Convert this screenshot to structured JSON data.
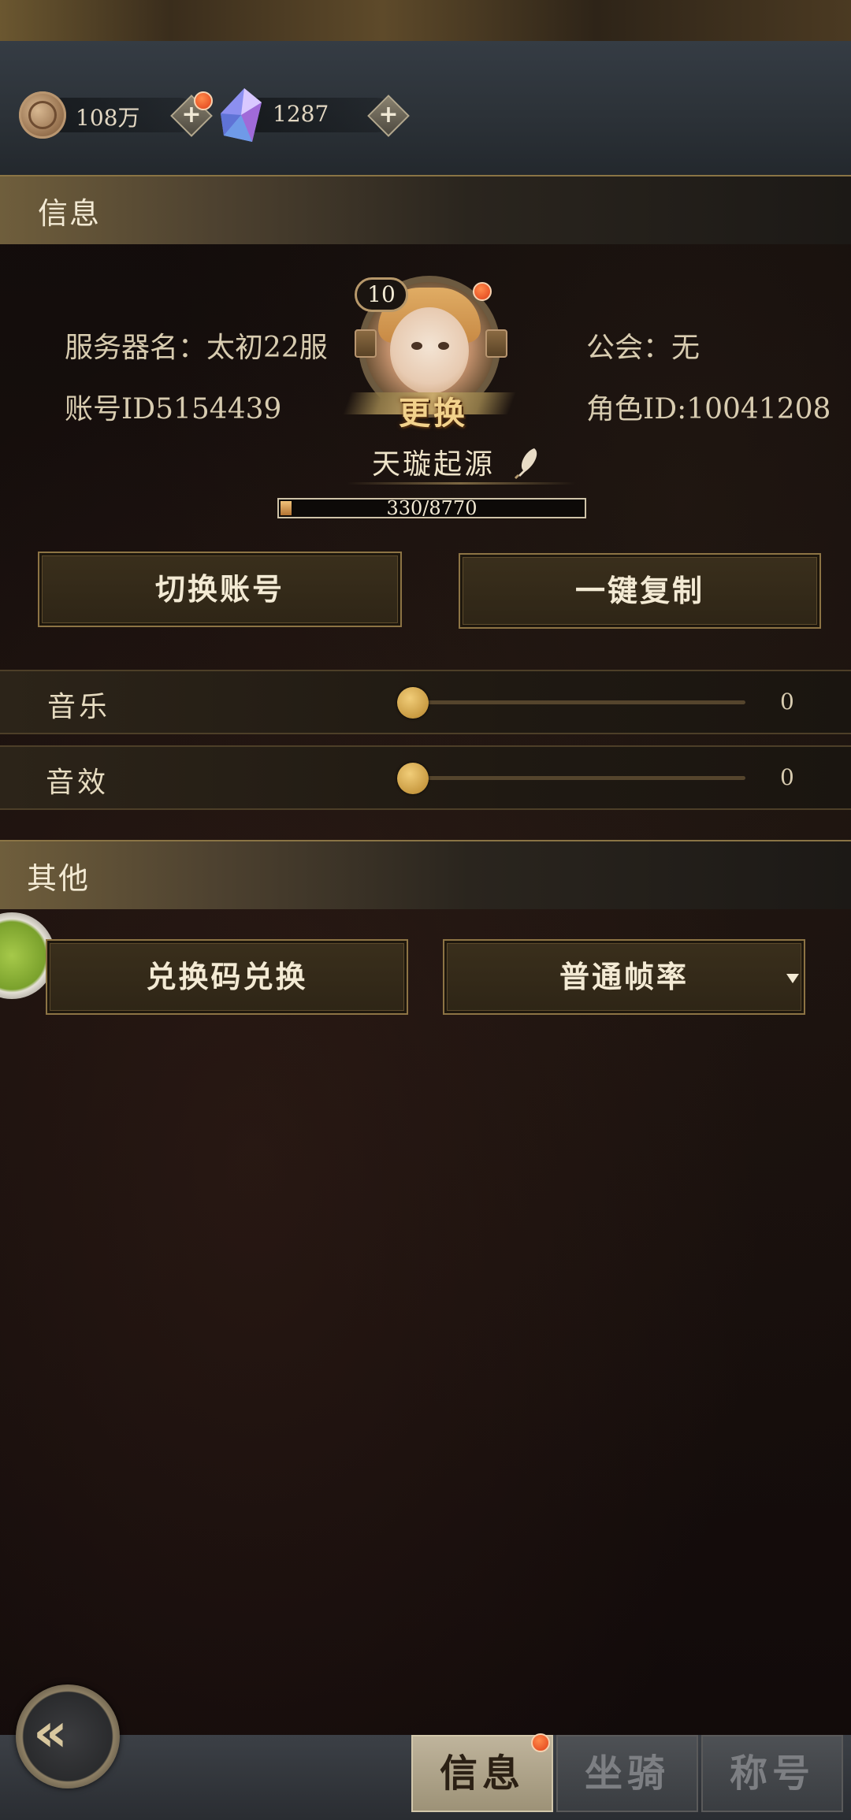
{
  "currency": {
    "coins": "108万",
    "crystals": "1287"
  },
  "info_section": {
    "title": "信息",
    "server_name": "服务器名：太初22服",
    "account_id": "账号ID5154439",
    "guild": "公会：无",
    "role_id": "角色ID:10041208",
    "level": "10",
    "change_avatar_label": "更换",
    "nickname": "天璇起源",
    "exp_text": "330/8770",
    "exp_fraction": 0.0376,
    "switch_account_label": "切换账号",
    "copy_label": "一键复制"
  },
  "audio": {
    "music_label": "音乐",
    "music_value": "0",
    "sfx_label": "音效",
    "sfx_value": "0"
  },
  "other_section": {
    "title": "其他",
    "redeem_label": "兑换码兑换",
    "framerate_selected": "普通帧率"
  },
  "tabs": [
    {
      "label": "信息",
      "active": true
    },
    {
      "label": "坐骑",
      "active": false
    },
    {
      "label": "称号",
      "active": false
    }
  ],
  "colors": {
    "accent_gold": "#c99b42",
    "notification_red": "#e0401a"
  }
}
